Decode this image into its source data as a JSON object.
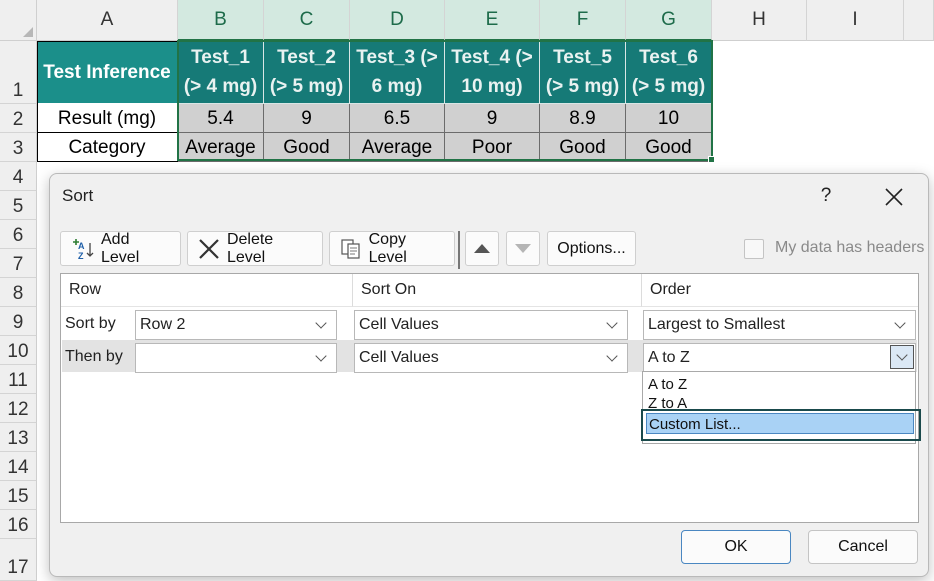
{
  "sheet": {
    "columns": [
      "A",
      "B",
      "C",
      "D",
      "E",
      "F",
      "G",
      "H",
      "I"
    ],
    "rows": [
      "1",
      "2",
      "3",
      "4",
      "5",
      "6",
      "7",
      "8",
      "9",
      "10",
      "11",
      "12",
      "13",
      "14",
      "15",
      "16",
      "17"
    ],
    "table": {
      "header_label": "Test Inference",
      "tests": [
        {
          "line1": "Test_1",
          "line2": "(> 4 mg)"
        },
        {
          "line1": "Test_2",
          "line2": "(> 5 mg)"
        },
        {
          "line1": "Test_3 (>",
          "line2": "6 mg)"
        },
        {
          "line1": "Test_4 (>",
          "line2": "10 mg)"
        },
        {
          "line1": "Test_5",
          "line2": "(> 5 mg)"
        },
        {
          "line1": "Test_6",
          "line2": "(> 5 mg)"
        }
      ],
      "result_label": "Result (mg)",
      "results": [
        "5.4",
        "9",
        "6.5",
        "9",
        "8.9",
        "10"
      ],
      "category_label": "Category",
      "categories": [
        "Average",
        "Good",
        "Average",
        "Poor",
        "Good",
        "Good"
      ]
    },
    "colors": {
      "header_teal": "#1b8f8a",
      "selection_green": "#217346",
      "gray_cells": "#d0d0d0"
    }
  },
  "dialog": {
    "title": "Sort",
    "help": "?",
    "toolbar": {
      "add_level": "Add Level",
      "delete_level": "Delete Level",
      "copy_level": "Copy Level",
      "options": "Options...",
      "my_data_has_headers": "My data has headers",
      "my_data_has_headers_checked": false
    },
    "columns": {
      "row": "Row",
      "sort_on": "Sort On",
      "order": "Order"
    },
    "levels": [
      {
        "label": "Sort by",
        "row": "Row 2",
        "sort_on": "Cell Values",
        "order": "Largest to Smallest"
      },
      {
        "label": "Then by",
        "row": "",
        "sort_on": "Cell Values",
        "order": "A to Z"
      }
    ],
    "order_dropdown": {
      "options": [
        "A to Z",
        "Z to A",
        "Custom List..."
      ],
      "highlighted": "Custom List..."
    },
    "ok": "OK",
    "cancel": "Cancel"
  }
}
